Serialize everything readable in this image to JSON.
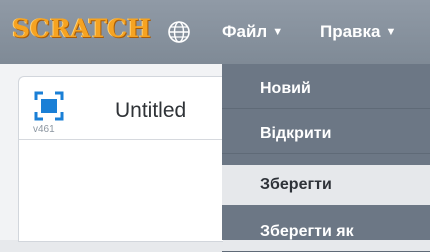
{
  "menubar": {
    "logo_text": "SCRATCH",
    "globe_icon": "globe-icon",
    "menus": [
      {
        "label": "Файл",
        "caret": "▼"
      },
      {
        "label": "Правка",
        "caret": "▼"
      }
    ]
  },
  "project": {
    "title": "Untitled",
    "version": "v461",
    "stage_icon": "fullscreen-icon"
  },
  "file_menu": {
    "items": [
      {
        "label": "Новий"
      },
      {
        "label": "Відкрити"
      },
      {
        "label": "Зберегти",
        "hovered": true
      },
      {
        "label": "Зберегти як"
      }
    ]
  },
  "colors": {
    "menubar": "#8a95a1",
    "dropdown": "#6c7785",
    "logo": "#f6a321",
    "hover": "#e6e8eb",
    "stage_icon": "#1a7fd6"
  }
}
